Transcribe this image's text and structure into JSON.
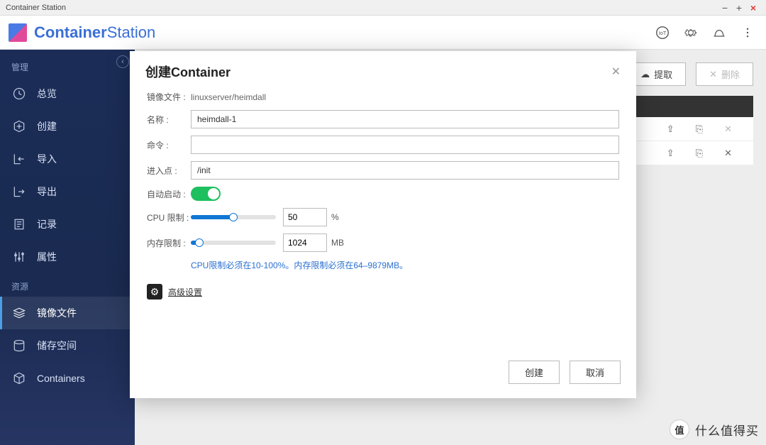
{
  "window": {
    "title": "Container Station"
  },
  "brand": {
    "bold": "Container",
    "thin": "Station"
  },
  "toolbar_icons": {
    "iot": "IoT",
    "settings": "settings",
    "activity": "activity",
    "more": "more"
  },
  "sidebar": {
    "sec_manage": "管理",
    "sec_resource": "资源",
    "items": {
      "overview": "总览",
      "create": "创建",
      "import": "导入",
      "export": "导出",
      "log": "记录",
      "properties": "属性",
      "images": "镜像文件",
      "storage": "储存空间",
      "containers": "Containers"
    }
  },
  "content": {
    "pull": "提取",
    "delete": "删除"
  },
  "modal": {
    "title": "创建Container",
    "labels": {
      "image": "镜像文件 :",
      "name": "名称 :",
      "command": "命令 :",
      "entrypoint": "进入点 :",
      "autostart": "自动启动 :",
      "cpu": "CPU 限制 :",
      "memory": "内存限制 :"
    },
    "values": {
      "image": "linuxserver/heimdall",
      "name": "heimdall-1",
      "command": "",
      "entrypoint": "/init",
      "cpu": "50",
      "cpu_unit": "%",
      "memory": "1024",
      "memory_unit": "MB",
      "cpu_slider_pct": 50,
      "mem_slider_pct": 10
    },
    "hint": "CPU限制必须在10-100%。内存限制必须在64–9879MB。",
    "advanced": "高级设置",
    "create_btn": "创建",
    "cancel_btn": "取消"
  },
  "watermark": {
    "char": "值",
    "text": "什么值得买"
  }
}
